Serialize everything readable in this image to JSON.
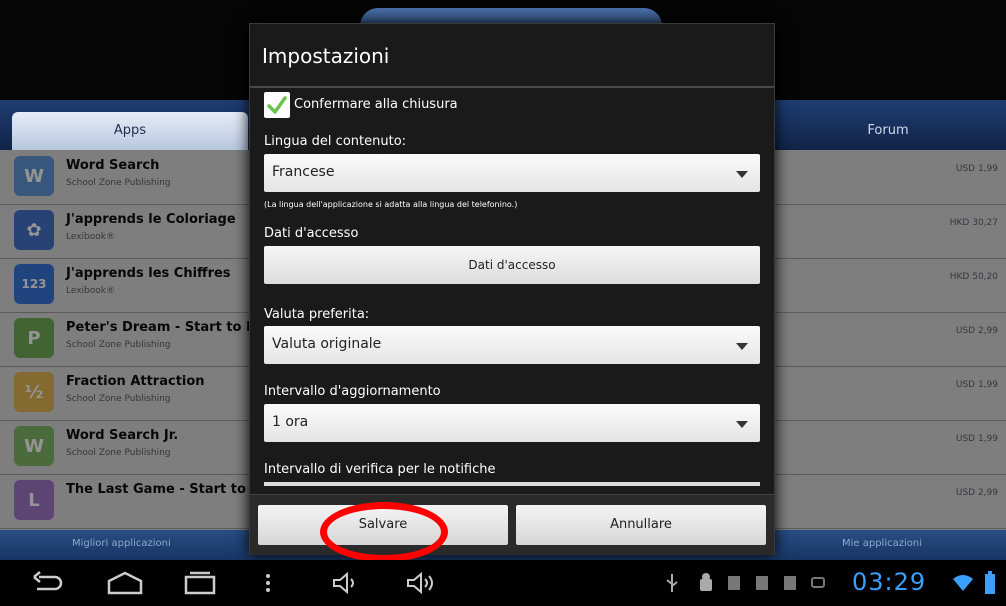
{
  "background": {
    "tabs": {
      "apps": "Apps",
      "forum": "Forum"
    },
    "rows": [
      {
        "title": "Word Search",
        "publisher": "School Zone Publishing",
        "price": "USD 1,99",
        "color": "#5a8fd6",
        "glyph": "W"
      },
      {
        "title": "J'apprends le Coloriage",
        "publisher": "Lexibook®",
        "price": "HKD 30,27",
        "color": "#3b6bc7",
        "glyph": "✿"
      },
      {
        "title": "J'apprends les Chiffres",
        "publisher": "Lexibook®",
        "price": "HKD 50,20",
        "color": "#2d6fd8",
        "glyph": "123"
      },
      {
        "title": "Peter's Dream - Start to Re",
        "publisher": "School Zone Publishing",
        "price": "USD 2,99",
        "color": "#6aa84f",
        "glyph": "P"
      },
      {
        "title": "Fraction Attraction",
        "publisher": "School Zone Publishing",
        "price": "USD 1,99",
        "color": "#e0b44a",
        "glyph": "½"
      },
      {
        "title": "Word Search Jr.",
        "publisher": "School Zone Publishing",
        "price": "USD 1,99",
        "color": "#7bb560",
        "glyph": "W"
      },
      {
        "title": "The Last Game - Start to Re",
        "publisher": "",
        "price": "USD 2,99",
        "color": "#9a6fc4",
        "glyph": "L"
      }
    ],
    "bottom_tabs": {
      "left": "Migliori applicazioni",
      "right": "Mie applicazioni"
    }
  },
  "dialog": {
    "title": "Impostazioni",
    "confirm_on_close": {
      "label": "Confermare alla chiusura",
      "checked": true
    },
    "content_language": {
      "label": "Lingua del contenuto:",
      "value": "Francese",
      "note": "(La lingua dell'applicazione si adatta alla lingua del telefonino.)"
    },
    "access_data": {
      "label": "Dati d'accesso",
      "button": "Dati d'accesso"
    },
    "currency": {
      "label": "Valuta preferita:",
      "value": "Valuta originale"
    },
    "update_interval": {
      "label": "Intervallo d'aggiornamento",
      "value": "1 ora"
    },
    "notification_interval": {
      "label": "Intervallo di verifica per le notifiche"
    },
    "buttons": {
      "save": "Salvare",
      "cancel": "Annullare"
    }
  },
  "statusbar": {
    "time": "03:29"
  },
  "colors": {
    "accent": "#3aa0ff",
    "annotation": "#ff0000",
    "check": "#6cc24a"
  }
}
